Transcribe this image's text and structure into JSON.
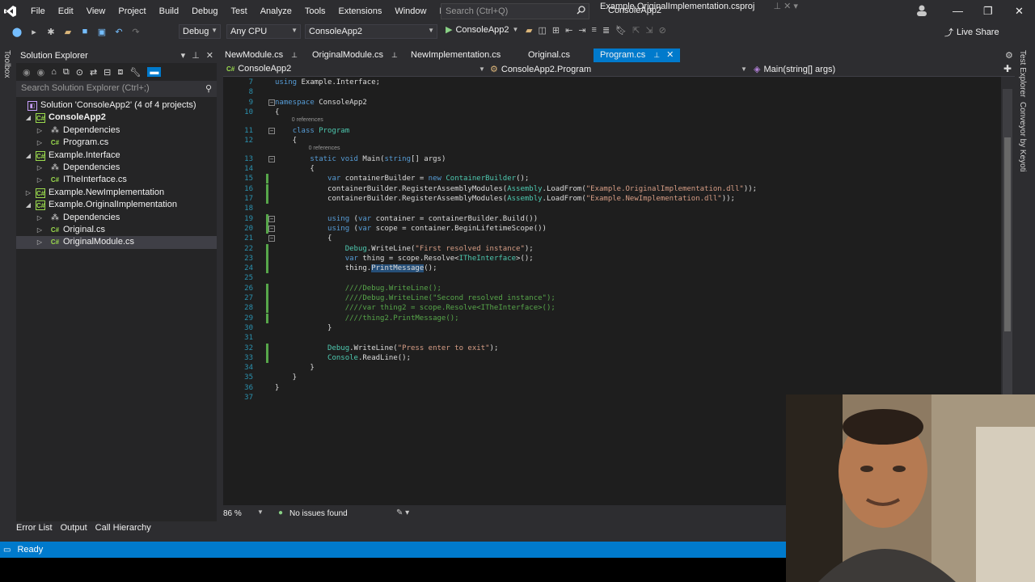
{
  "menu": {
    "items": [
      "File",
      "Edit",
      "View",
      "Project",
      "Build",
      "Debug",
      "Test",
      "Analyze",
      "Tools",
      "Extensions",
      "Window",
      "Help"
    ],
    "search_placeholder": "Search (Ctrl+Q)",
    "solution_name": "ConsoleApp2"
  },
  "toolbar": {
    "config": "Debug",
    "platform": "Any CPU",
    "startup_project": "ConsoleApp2",
    "run_label": "ConsoleApp2",
    "live_share": "Live Share"
  },
  "left_rail": {
    "toolbox": "Toolbox"
  },
  "right_rail": {
    "test_explorer": "Test Explorer",
    "conveyor": "Conveyor by Keyoti"
  },
  "solution_explorer": {
    "title": "Solution Explorer",
    "search_placeholder": "Search Solution Explorer (Ctrl+;)",
    "items": [
      {
        "label": "Solution 'ConsoleApp2' (4 of 4 projects)",
        "indent": 0,
        "expander": "",
        "icon": "sln",
        "bold": false,
        "selected": false
      },
      {
        "label": "ConsoleApp2",
        "indent": 1,
        "expander": "◢",
        "icon": "proj",
        "bold": true,
        "selected": false
      },
      {
        "label": "Dependencies",
        "indent": 2,
        "expander": "▷",
        "icon": "dep",
        "bold": false,
        "selected": false
      },
      {
        "label": "Program.cs",
        "indent": 2,
        "expander": "▷",
        "icon": "cs",
        "bold": false,
        "selected": false
      },
      {
        "label": "Example.Interface",
        "indent": 1,
        "expander": "◢",
        "icon": "proj",
        "bold": false,
        "selected": false
      },
      {
        "label": "Dependencies",
        "indent": 2,
        "expander": "▷",
        "icon": "dep",
        "bold": false,
        "selected": false
      },
      {
        "label": "ITheInterface.cs",
        "indent": 2,
        "expander": "▷",
        "icon": "cs",
        "bold": false,
        "selected": false
      },
      {
        "label": "Example.NewImplementation",
        "indent": 1,
        "expander": "▷",
        "icon": "proj",
        "bold": false,
        "selected": false
      },
      {
        "label": "Example.OriginalImplementation",
        "indent": 1,
        "expander": "◢",
        "icon": "proj",
        "bold": false,
        "selected": false
      },
      {
        "label": "Dependencies",
        "indent": 2,
        "expander": "▷",
        "icon": "dep",
        "bold": false,
        "selected": false
      },
      {
        "label": "Original.cs",
        "indent": 2,
        "expander": "▷",
        "icon": "cs",
        "bold": false,
        "selected": false
      },
      {
        "label": "OriginalModule.cs",
        "indent": 2,
        "expander": "▷",
        "icon": "cs",
        "bold": false,
        "selected": true
      }
    ]
  },
  "tabs": [
    {
      "label": "NewModule.cs",
      "pinned": true,
      "active": false
    },
    {
      "label": "OriginalModule.cs",
      "pinned": true,
      "active": false
    },
    {
      "label": "NewImplementation.cs",
      "pinned": false,
      "active": false
    },
    {
      "label": "Original.cs",
      "pinned": false,
      "active": false
    },
    {
      "label": "Program.cs",
      "pinned": true,
      "active": true
    }
  ],
  "tab_right": "Example.OriginalImplementation.csproj",
  "navbar": {
    "project": "ConsoleApp2",
    "type": "ConsoleApp2.Program",
    "member": "Main(string[] args)"
  },
  "code_lines": [
    {
      "n": "7",
      "text": "using Example.Interface;"
    },
    {
      "n": "8",
      "text": ""
    },
    {
      "n": "9",
      "text": "namespace ConsoleApp2"
    },
    {
      "n": "10",
      "text": "{"
    },
    {
      "n": "11",
      "text": "    class Program",
      "ref": "0 references"
    },
    {
      "n": "12",
      "text": "    {"
    },
    {
      "n": "13",
      "text": "        static void Main(string[] args)",
      "ref": "0 references"
    },
    {
      "n": "14",
      "text": "        {"
    },
    {
      "n": "15",
      "text": "            var containerBuilder = new ContainerBuilder();"
    },
    {
      "n": "16",
      "text": "            containerBuilder.RegisterAssemblyModules(Assembly.LoadFrom(\"Example.OriginalImplementation.dll\"));"
    },
    {
      "n": "17",
      "text": "            containerBuilder.RegisterAssemblyModules(Assembly.LoadFrom(\"Example.NewImplementation.dll\"));"
    },
    {
      "n": "18",
      "text": ""
    },
    {
      "n": "19",
      "text": "            using (var container = containerBuilder.Build())"
    },
    {
      "n": "20",
      "text": "            using (var scope = container.BeginLifetimeScope())"
    },
    {
      "n": "21",
      "text": "            {"
    },
    {
      "n": "22",
      "text": "                Debug.WriteLine(\"First resolved instance\");"
    },
    {
      "n": "23",
      "text": "                var thing = scope.Resolve<ITheInterface>();"
    },
    {
      "n": "24",
      "text": "                thing.PrintMessage();"
    },
    {
      "n": "25",
      "text": ""
    },
    {
      "n": "26",
      "text": "                ////Debug.WriteLine();"
    },
    {
      "n": "27",
      "text": "                ////Debug.WriteLine(\"Second resolved instance\");"
    },
    {
      "n": "28",
      "text": "                ////var thing2 = scope.Resolve<ITheInterface>();"
    },
    {
      "n": "29",
      "text": "                ////thing2.PrintMessage();"
    },
    {
      "n": "30",
      "text": "            }"
    },
    {
      "n": "31",
      "text": ""
    },
    {
      "n": "32",
      "text": "            Debug.WriteLine(\"Press enter to exit\");"
    },
    {
      "n": "33",
      "text": "            Console.ReadLine();"
    },
    {
      "n": "34",
      "text": "        }"
    },
    {
      "n": "35",
      "text": "    }"
    },
    {
      "n": "36",
      "text": "}"
    },
    {
      "n": "37",
      "text": ""
    }
  ],
  "editor_status": {
    "zoom": "86 %",
    "issues": "No issues found"
  },
  "bottom_tabs": [
    "Error List",
    "Output",
    "Call Hierarchy"
  ],
  "status_bar": {
    "text": "Ready"
  },
  "colors": {
    "accent": "#007acc",
    "background": "#1e1e1e",
    "chrome": "#2d2d30"
  }
}
